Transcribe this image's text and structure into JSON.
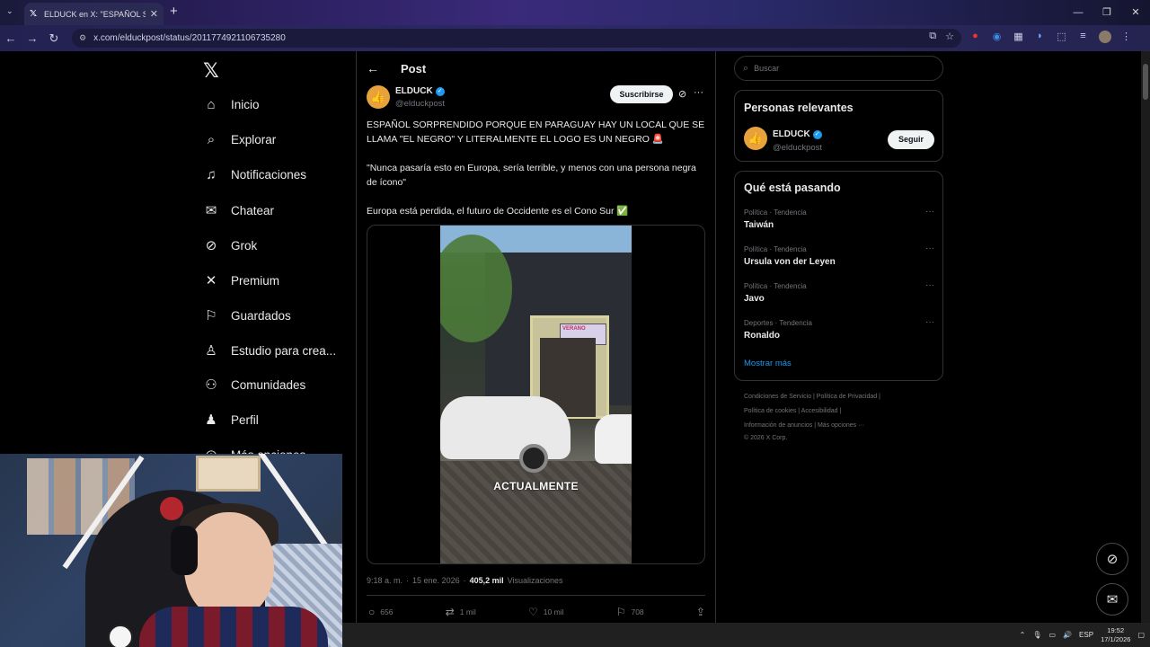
{
  "browser": {
    "tab_title": "ELDUCK en X: \"ESPAÑOL S...",
    "url": "x.com/elduckpost/status/2011774921106735280",
    "new_tab": "+",
    "tab_close": "✕"
  },
  "sidebar": {
    "items": [
      {
        "label": "Inicio",
        "icon": "home-icon",
        "glyph": "⌂"
      },
      {
        "label": "Explorar",
        "icon": "search-icon",
        "glyph": "⌕"
      },
      {
        "label": "Notificaciones",
        "icon": "bell-icon",
        "glyph": "🔔"
      },
      {
        "label": "Chatear",
        "icon": "mail-icon",
        "glyph": "✉"
      },
      {
        "label": "Grok",
        "icon": "grok-icon",
        "glyph": "⊘"
      },
      {
        "label": "Premium",
        "icon": "x-icon",
        "glyph": "𝕏"
      },
      {
        "label": "Guardados",
        "icon": "bookmark-icon",
        "glyph": "🔖"
      },
      {
        "label": "Estudio para crea...",
        "icon": "studio-icon",
        "glyph": "♙"
      },
      {
        "label": "Comunidades",
        "icon": "people-icon",
        "glyph": "👥"
      },
      {
        "label": "Perfil",
        "icon": "person-icon",
        "glyph": "👤"
      },
      {
        "label": "Más opciones",
        "icon": "more-circle-icon",
        "glyph": "⋯"
      }
    ]
  },
  "post": {
    "header": "Post",
    "author_name": "ELDUCK",
    "author_handle": "@elduckpost",
    "subscribe_label": "Suscribirse",
    "text_1": "ESPAÑOL SORPRENDIDO PORQUE EN PARAGUAY HAY UN LOCAL QUE SE LLAMA \"EL NEGRO\" Y LITERALMENTE EL LOGO ES UN NEGRO 🚨",
    "text_2": "\"Nunca pasaría esto en Europa, sería terrible, y menos con una persona negra de ícono\"",
    "text_3": "Europa está perdida, el futuro de Occidente es el Cono Sur ✅",
    "video_caption": "ACTUALMENTE",
    "video_sign": "VERANO",
    "time": "9:18 a. m.",
    "date": "15 ene. 2026",
    "views_count": "405,2 mil",
    "views_label": "Visualizaciones",
    "replies": "656",
    "reposts": "1 mil",
    "likes": "10 mil",
    "bookmarks": "708"
  },
  "right": {
    "search_placeholder": "Buscar",
    "relevant_title": "Personas relevantes",
    "relevant_name": "ELDUCK",
    "relevant_handle": "@elduckpost",
    "follow_label": "Seguir",
    "trending_title": "Qué está pasando",
    "trends": [
      {
        "category": "Política · Tendencia",
        "name": "Taiwán"
      },
      {
        "category": "Política · Tendencia",
        "name": "Ursula von der Leyen"
      },
      {
        "category": "Política · Tendencia",
        "name": "Javo"
      },
      {
        "category": "Deportes · Tendencia",
        "name": "Ronaldo"
      }
    ],
    "show_more": "Mostrar más",
    "footer_1": "Condiciones de Servicio  |  Política de Privacidad  |",
    "footer_2": "Política de cookies  |  Accesibilidad  |",
    "footer_3": "Información de anuncios  |  Más opciones ···",
    "footer_4": "© 2026 X Corp."
  },
  "taskbar": {
    "lang": "ESP",
    "time": "19:52",
    "date": "17/1/2026"
  },
  "colors": {
    "accent": "#1d9bf0",
    "background": "#000000",
    "border": "#2f3336",
    "muted": "#71767b"
  }
}
